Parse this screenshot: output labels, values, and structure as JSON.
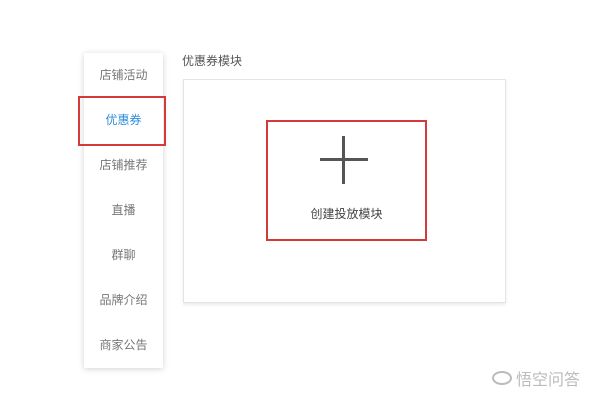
{
  "sidebar": {
    "items": [
      {
        "label": "店铺活动",
        "active": false
      },
      {
        "label": "优惠券",
        "active": true
      },
      {
        "label": "店铺推荐",
        "active": false
      },
      {
        "label": "直播",
        "active": false
      },
      {
        "label": "群聊",
        "active": false
      },
      {
        "label": "品牌介绍",
        "active": false
      },
      {
        "label": "商家公告",
        "active": false
      }
    ]
  },
  "main": {
    "section_title": "优惠券模块",
    "create_button": {
      "icon": "plus-icon",
      "label": "创建投放模块"
    }
  },
  "watermark": {
    "text": "悟空问答"
  },
  "colors": {
    "active": "#2b8dd9",
    "highlight": "#d43a3a",
    "text_muted": "#777777"
  }
}
